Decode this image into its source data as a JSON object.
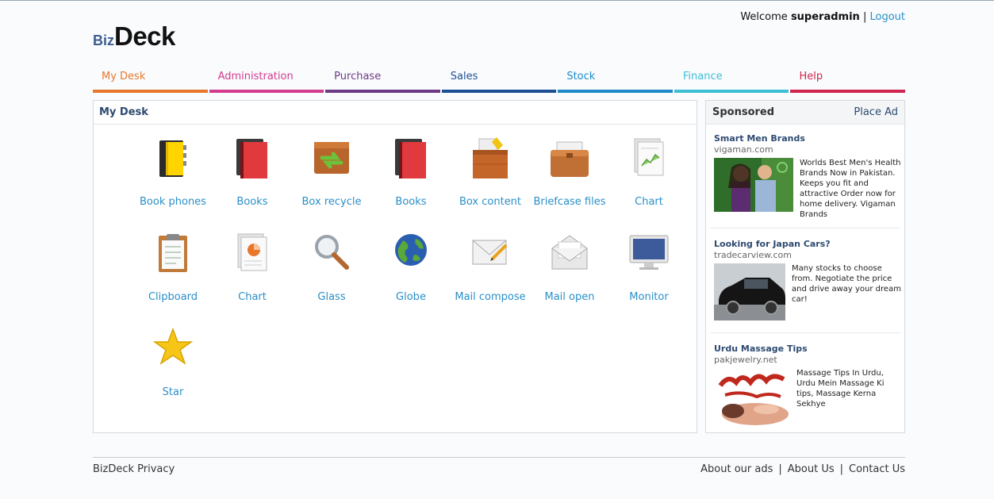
{
  "header": {
    "welcome_text": "Welcome",
    "username": "superadmin",
    "separator": "|",
    "logout_label": "Logout",
    "logo_small": "Biz",
    "logo_large": "Deck"
  },
  "nav": [
    {
      "label": "My Desk",
      "color": "#e8772a"
    },
    {
      "label": "Administration",
      "color": "#d33c8f"
    },
    {
      "label": "Purchase",
      "color": "#6e3a86"
    },
    {
      "label": "Sales",
      "color": "#1d4f95"
    },
    {
      "label": "Stock",
      "color": "#1d8bc9"
    },
    {
      "label": "Finance",
      "color": "#3fbfd6"
    },
    {
      "label": "Help",
      "color": "#d0264f"
    }
  ],
  "desk": {
    "title": "My Desk",
    "items": [
      {
        "label": "Book phones",
        "icon": "book-phones-icon"
      },
      {
        "label": "Books",
        "icon": "books-icon"
      },
      {
        "label": "Box recycle",
        "icon": "box-recycle-icon"
      },
      {
        "label": "Books",
        "icon": "books-icon"
      },
      {
        "label": "Box content",
        "icon": "box-content-icon"
      },
      {
        "label": "Briefcase files",
        "icon": "briefcase-icon"
      },
      {
        "label": "Chart",
        "icon": "chart-document-icon"
      },
      {
        "label": "Clipboard",
        "icon": "clipboard-icon"
      },
      {
        "label": "Chart",
        "icon": "pie-chart-document-icon"
      },
      {
        "label": "Glass",
        "icon": "magnifying-glass-icon"
      },
      {
        "label": "Globe",
        "icon": "globe-icon"
      },
      {
        "label": "Mail compose",
        "icon": "mail-compose-icon"
      },
      {
        "label": "Mail open",
        "icon": "mail-open-icon"
      },
      {
        "label": "Monitor",
        "icon": "monitor-icon"
      },
      {
        "label": "Star",
        "icon": "star-icon"
      }
    ]
  },
  "sponsored": {
    "title": "Sponsored",
    "place_ad": "Place Ad",
    "ads": [
      {
        "title": "Smart Men Brands",
        "url": "vigaman.com",
        "text": "Worlds Best Men's Health Brands Now in Pakistan. Keeps you fit and attractive Order now for home delivery. Vigaman Brands",
        "image": "couple-photo"
      },
      {
        "title": "Looking for Japan Cars?",
        "url": "tradecarview.com",
        "text": "Many stocks to choose from. Negotiate the price and drive away your dream car!",
        "image": "black-car-photo"
      },
      {
        "title": "Urdu Massage Tips",
        "url": "pakjewelry.net",
        "text": "Massage Tips In Urdu, Urdu Mein Massage Ki tips, Massage Kerna Sekhye",
        "image": "massage-urdu-banner"
      }
    ]
  },
  "footer": {
    "privacy": "BizDeck Privacy",
    "links": [
      "About our ads",
      "About Us",
      "Contact Us"
    ]
  }
}
